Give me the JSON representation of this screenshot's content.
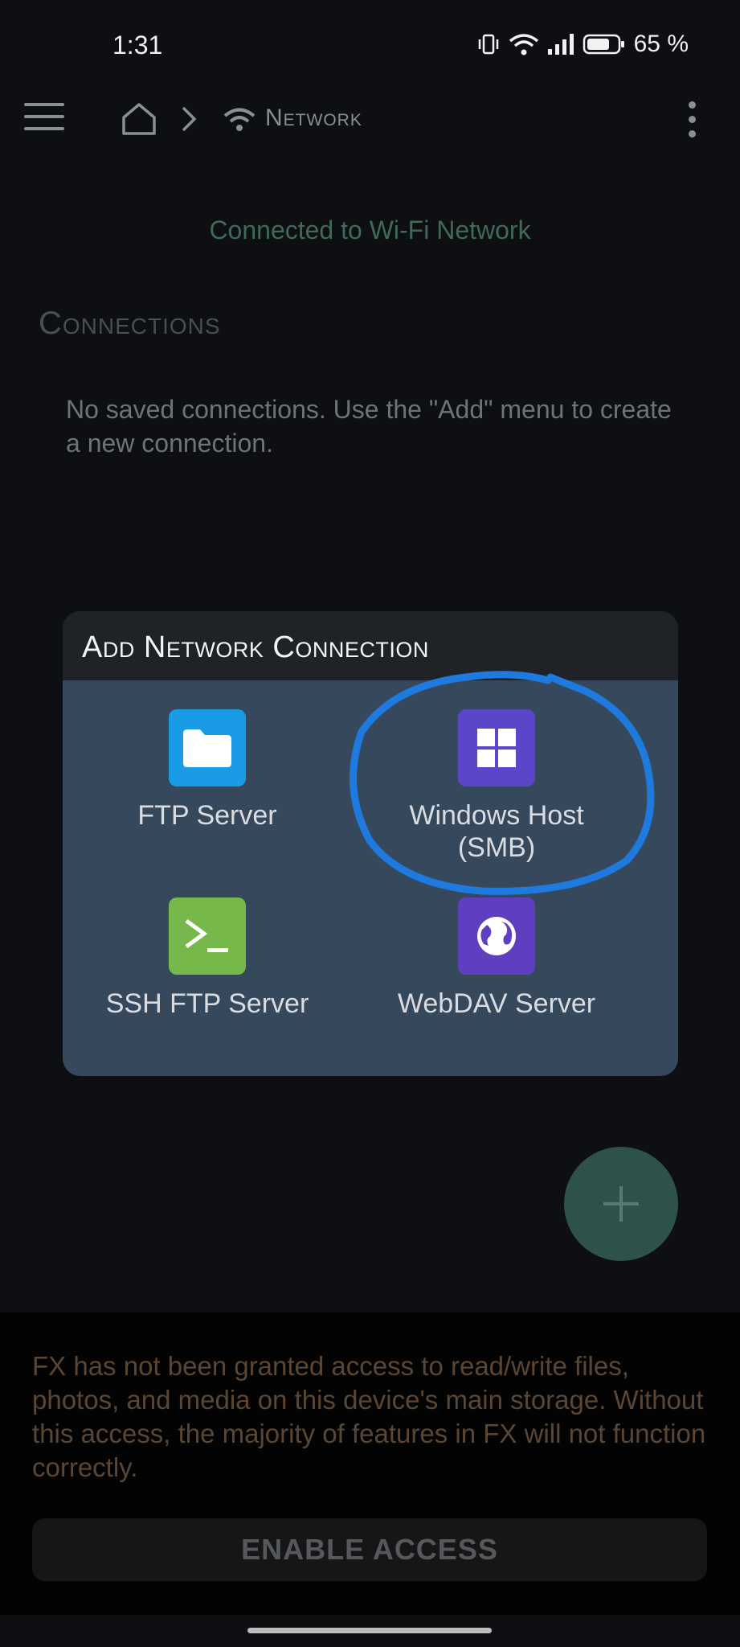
{
  "status_bar": {
    "time": "1:31",
    "battery_percent": "65 %",
    "icons": [
      "vibrate-icon",
      "wifi-icon",
      "signal-icon",
      "battery-icon"
    ]
  },
  "toolbar": {
    "menu_icon": "hamburger-menu-icon",
    "home_icon": "home-icon",
    "chevron_icon": "chevron-right-icon",
    "crumb_icon": "wifi-icon",
    "crumb_label": "Network",
    "overflow_icon": "more-vert-icon"
  },
  "main": {
    "connection_status": "Connected to Wi-Fi Network",
    "section_title": "Connections",
    "empty_message": "No saved connections. Use the \"Add\" menu to create a new connection."
  },
  "dialog": {
    "title": "Add Network Connection",
    "options": [
      {
        "label": "FTP Server",
        "icon": "folder-icon",
        "color": "#1a9be6"
      },
      {
        "label": "Windows Host (SMB)",
        "icon": "windows-icon",
        "color": "#5b45c9"
      },
      {
        "label": "SSH FTP Server",
        "icon": "terminal-icon",
        "color": "#76b84a"
      },
      {
        "label": "WebDAV Server",
        "icon": "globe-icon",
        "color": "#5f3fbf"
      }
    ]
  },
  "fab": {
    "icon": "plus-icon"
  },
  "banner": {
    "message": "FX has not been granted access to read/write files, photos, and media on this device's main storage. Without this access, the majority of features in FX will not function correctly.",
    "button_label": "ENABLE ACCESS"
  },
  "colors": {
    "background": "#0d0f12",
    "dialog": "#36495c",
    "highlight": "#1f7ae0",
    "fab": "#2e5149"
  }
}
